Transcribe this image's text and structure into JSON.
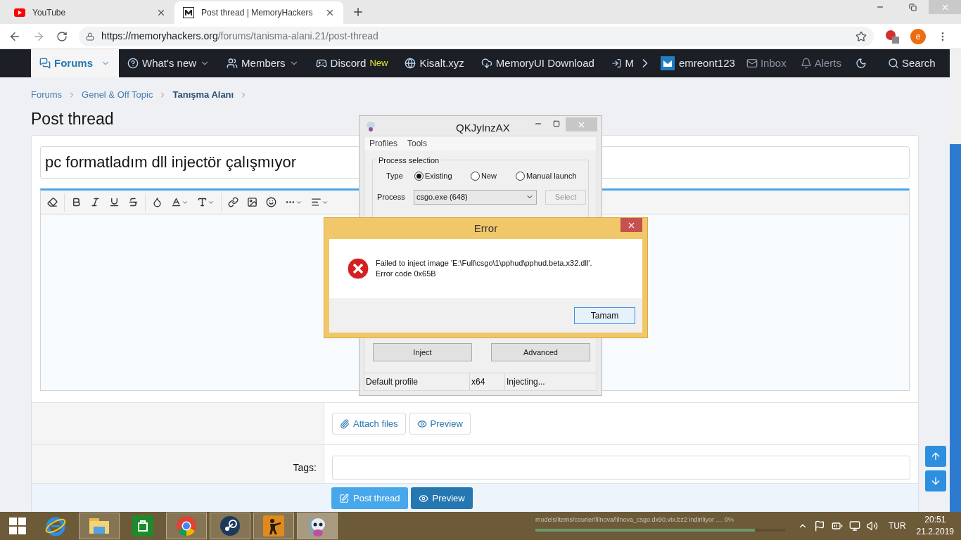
{
  "browser": {
    "tabs": [
      {
        "title": "YouTube",
        "selected": false
      },
      {
        "title": "Post thread | MemoryHackers",
        "selected": true
      }
    ],
    "url": {
      "host": "https://memoryhackers.org",
      "path": "/forums/tanisma-alani.21/post-thread"
    },
    "profile_initial": "e"
  },
  "nav": {
    "items": [
      {
        "label": "Forums",
        "dropdown": true,
        "selected": true
      },
      {
        "label": "What's new",
        "dropdown": true,
        "selected": false
      },
      {
        "label": "Members",
        "dropdown": true,
        "selected": false
      },
      {
        "label": "Discord",
        "badge": "New",
        "dropdown": false,
        "selected": false
      },
      {
        "label": "Kisalt.xyz",
        "dropdown": false,
        "selected": false
      },
      {
        "label": "MemoryUI Download",
        "dropdown": false,
        "selected": false
      },
      {
        "label": "M",
        "dropdown": false,
        "selected": false
      }
    ],
    "user": "emreont123",
    "right": [
      {
        "label": "Inbox",
        "dimmed": true
      },
      {
        "label": "Alerts",
        "dimmed": true
      },
      {
        "dimmed": false
      },
      {
        "label": "Search",
        "dimmed": false
      }
    ]
  },
  "breadcrumbs": [
    {
      "label": "Forums",
      "current": false
    },
    {
      "label": "Genel & Off Topic",
      "current": false
    },
    {
      "label": "Tanışma Alanı",
      "current": true
    }
  ],
  "page_title": "Post thread",
  "form": {
    "title_value": "pc formatladım dll injectör çalışmıyor",
    "toolbar": [
      {
        "buttons": [
          {
            "kind": "eraser",
            "dropdown": false
          }
        ]
      },
      {
        "buttons": [
          {
            "kind": "bold",
            "dropdown": false
          },
          {
            "kind": "italic",
            "dropdown": false
          },
          {
            "kind": "underline",
            "dropdown": false
          },
          {
            "kind": "strike",
            "dropdown": false
          }
        ]
      },
      {
        "buttons": [
          {
            "kind": "color",
            "dropdown": false
          },
          {
            "kind": "font",
            "dropdown": true
          },
          {
            "kind": "size",
            "dropdown": true
          }
        ]
      },
      {
        "buttons": [
          {
            "kind": "link",
            "dropdown": false
          },
          {
            "kind": "image",
            "dropdown": false
          },
          {
            "kind": "smiley",
            "dropdown": false
          },
          {
            "kind": "more",
            "dropdown": true
          },
          {
            "kind": "align",
            "dropdown": true
          }
        ]
      }
    ],
    "attach_label": "Attach files",
    "preview_label": "Preview",
    "tags_label": "Tags:",
    "submit_label": "Post thread",
    "submit_preview_label": "Preview"
  },
  "injector": {
    "title": "QKJyInzAX",
    "menu": [
      "Profiles",
      "Tools"
    ],
    "group_title": "Process selection",
    "type_label": "Type",
    "types": [
      {
        "label": "Existing",
        "selected": true
      },
      {
        "label": "New",
        "selected": false
      },
      {
        "label": "Manual launch",
        "selected": false
      }
    ],
    "process_label": "Process",
    "process_value": "csgo.exe (648)",
    "select_label": "Select",
    "select_disabled": true,
    "buttons": [
      "Inject",
      "Advanced"
    ],
    "status": [
      "Default profile",
      "x64",
      "Injecting..."
    ]
  },
  "error_dialog": {
    "title": "Error",
    "message": [
      "Failed to inject image 'E:\\Full\\csgo\\1\\pphud\\pphud.beta.x32.dll'.",
      "Error code 0x65B"
    ],
    "button": "Tamam"
  },
  "taskbar": {
    "apps": [
      {
        "kind": "ie",
        "running": false,
        "active": false
      },
      {
        "kind": "explorer",
        "running": true,
        "active": false
      },
      {
        "kind": "store",
        "running": false,
        "active": false
      },
      {
        "kind": "chrome",
        "running": true,
        "active": false
      },
      {
        "kind": "steam",
        "running": true,
        "active": false
      },
      {
        "kind": "csgo",
        "running": true,
        "active": false
      },
      {
        "kind": "injector",
        "running": true,
        "active": true
      }
    ],
    "download": {
      "text": "models/items/courier/lilnova/lilnova_csgo.dx90.vtx.bz2 indiriliyor .... 0%",
      "level": 0.88
    },
    "language": "TUR",
    "time": "20:51",
    "date": "21.2.2019"
  }
}
